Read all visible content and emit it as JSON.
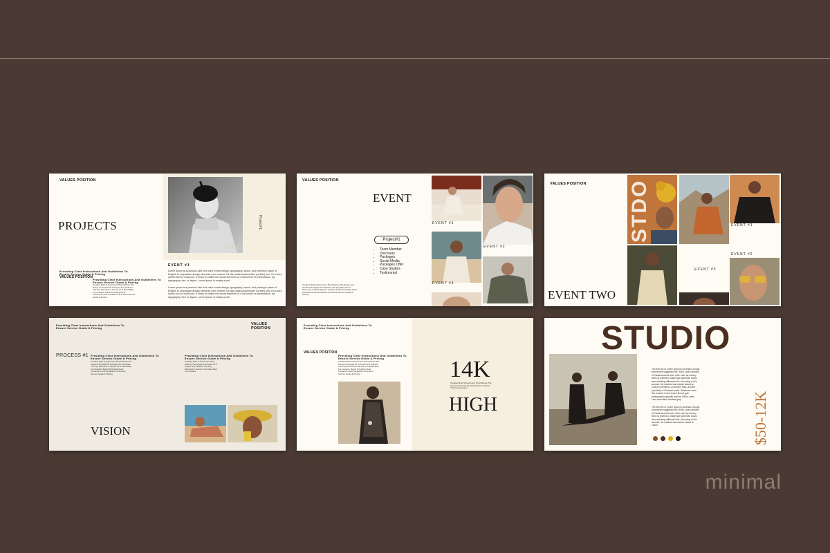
{
  "colors": {
    "background": "#4a3a33",
    "slide_cream": "#fdfbf3",
    "slide_warm": "#f6efdf",
    "accent_brown": "#4a2e22",
    "accent_orange": "#c0753a"
  },
  "slide1": {
    "header": "VALUES POSITION",
    "title": "PROJECTS",
    "vertical_label": "Project#1",
    "photo_caption": "VOCE",
    "guide_line1": "Providing Clear Instructions And Guidelines To",
    "guide_line2": "Ensure Service Guide & Pricing",
    "section_title": "VALUES POSITION",
    "sub_guide1": "Providing Clear Instructions And Guidelines To",
    "sub_guide2": "Ensure Service Guide & Pricing",
    "sub_body": "Creative Brief Is Document That Defines The Scope And Goals Of A Project And Outlines The Key Elements It Serves As A Road Map For Creative Teams Providing Clear Instructions And Guidelines To Ensure Service Guide & Pricing",
    "event_label": "EVENT #1",
    "para1": "Lorem ipsum is a pseudo-Latin text used in web design, typography, layout, and printing in place of English to emphasise design elements over content. It's also called placeholder (or filler) text. It's a very useful tool for mock-ups. It helps to outline the visual elements of a document or presentation, eg typography, font, or layout. Lorem ipsum is mostly a part",
    "para2": "Lorem ipsum is a pseudo-Latin text used in web design, typography, layout, and printing in place of English to emphasise design elements over content. It's also called placeholder (or filler) text. It's a very useful tool for mock-ups. It helps to outline the visual elements of a document or presentation, eg typography, font, or layout. Lorem ipsum is mostly a part"
  },
  "slide2": {
    "header": "VALUES POSITION",
    "title": "EVENT",
    "pill": "Project#1",
    "bullets": [
      "Team Member",
      "Discovery",
      "Packages",
      "Social Media",
      "Packages Offer",
      "Case Studies",
      "Testimonial"
    ],
    "brief": "Creative Brief Is Document That Defines The Scope And Goals Of A Project And Outlines The Key Elements It Serves As A Road Map For Creative Teams Providing Clear Instructions And Guidelines To Ensure Service Guide & Pricing",
    "event1": "EVENT #1",
    "event2": "EVENT #2",
    "event3": "EVENT #3"
  },
  "slide3": {
    "header": "VALUES POSITION",
    "vertical_word": "STDO",
    "title": "EVENT TWO",
    "event1": "EVENT #1",
    "event2": "EVENT #2",
    "event3": "EVENT #3"
  },
  "slide4": {
    "top_guide1": "Providing Clear Instructions And Guidelines To",
    "top_guide2": "Ensure Service Guide & Pricing",
    "header": "VALUES POSITION",
    "process": "PROCESS #1",
    "col1_title1": "Providing Clear Instructions And Guidelines To",
    "col1_title2": "Ensure Service Guide & Pricing",
    "col1_body": "Creative Brief Is Document That Defines The Scope And Goals Of A Project And Outlines The Key Elements It Serves As A Road Map For Creative Teams Providing Clear Instructions And Guidelines To Ensure Service Guide & Pricing",
    "col2_title1": "Providing Clear Instructions And Guidelines To",
    "col2_title2": "Ensure Service Guide & Pricing",
    "col2_body": "Creative Brief Is Document That Defines The Scope And Goals Of A Project And Outlines The Key Elements It Serves As A Road Map For Creative",
    "title": "VISION"
  },
  "slide5": {
    "top_guide1": "Providing Clear Instructions And Guidelines To",
    "top_guide2": "Ensure Service Guide & Pricing",
    "header": "VALUES POSITION",
    "guide1": "Providing Clear Instructions And Guidelines To",
    "guide2": "Ensure Service Guide & Pricing",
    "body": "Creative Brief Is Document That Defines The Scope And Goals Of A Project And Outlines The Key Elements It Serves As A Road Map For Creative Teams Providing Clear Instructions And Guidelines To Ensure Service Guide & Pricing",
    "big_number": "14K",
    "mid_text": "Creative Brief Is Document That Defines The Scope And Goals Of A Project And Outlines The Key Elements",
    "big_word": "HIGH"
  },
  "slide6": {
    "title": "STUDIO",
    "para1": "The first use of Lorem Ipsum is uncertain, though somewhere suggested the 1500s, when sections of Classical works were often used as dummy texts by printers to make type specimen books demonstrating different fonts. According to this account, the material was chosen based on Cicero's De finibus, an ancient book, and the popularity of Classical works. Whatever it was first created, Lorem ipsum did not gain widespread popularity until the 1960s, when Letra seminated Letraset grap.",
    "para2": "The first use of Lorem Ipsum is uncertain, though somewhere suggested the 1500s, when sections of Classical works were often used as dummy texts by printers to make type specimen books demonstrating different fonts. According to this account, the material was chosen based on Latin's",
    "price": "$50-12K",
    "swatches": [
      "#8a4d28",
      "#4a2e22",
      "#e0b020",
      "#111111"
    ]
  },
  "corner_word": "minimal"
}
